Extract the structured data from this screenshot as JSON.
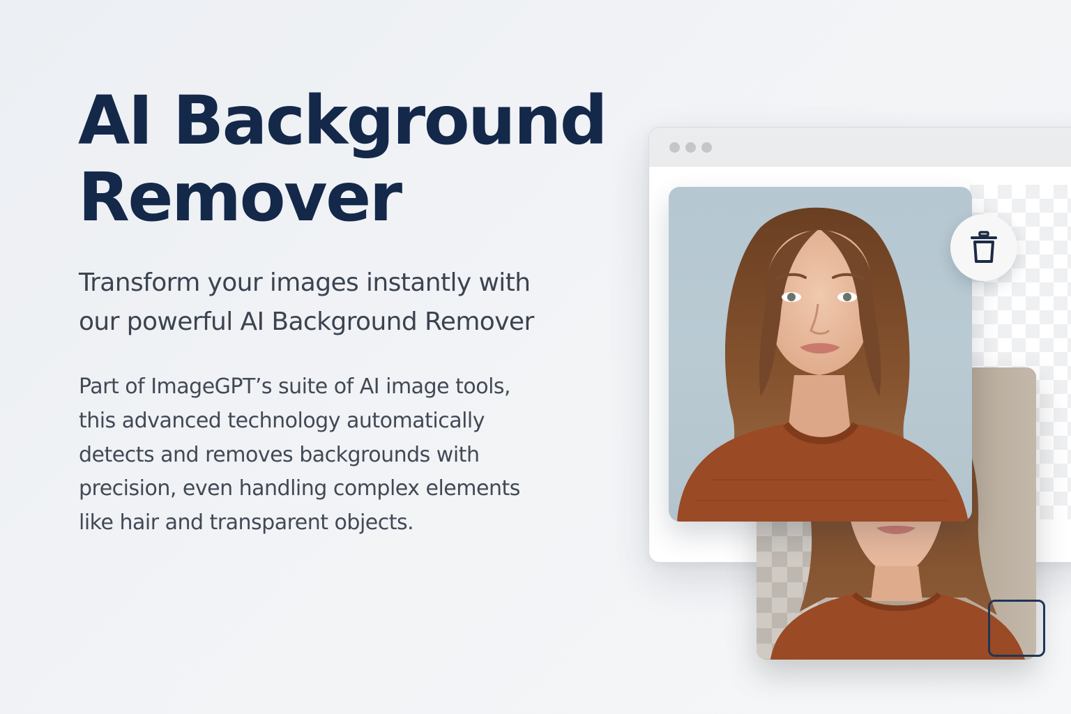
{
  "hero": {
    "title_lines": [
      "AI Background",
      "Remover"
    ],
    "subtitle_lines": [
      "Transform your images instantly with",
      "our powerful AI Background Remover"
    ],
    "body_lines": [
      "Part of ImageGPT’s suite of AI image tools,",
      "this advanced technology automatically",
      "detects and removes backgrounds with",
      "precision, even handling complex elements",
      "like hair and transparent objects."
    ]
  },
  "mockup": {
    "window_dots": 3,
    "icons": {
      "delete": "trash-icon",
      "select": "selection-frame"
    }
  },
  "colors": {
    "title": "#14284a",
    "text": "#3b4350",
    "accent_frame": "#1f3556",
    "photo_background": "#b9cad3",
    "sweater": "#9a4a24"
  }
}
